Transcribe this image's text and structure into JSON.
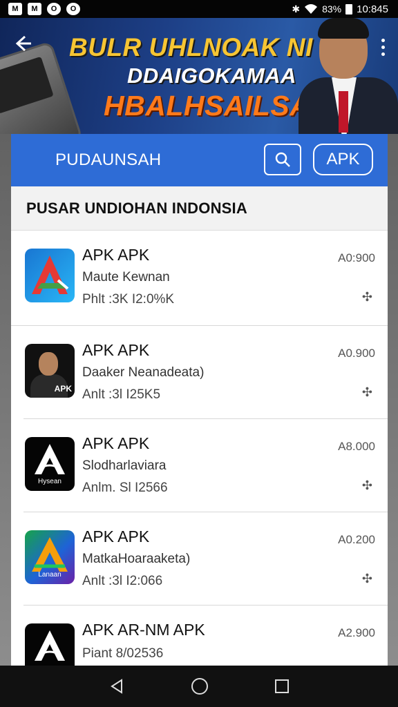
{
  "status_bar": {
    "icons_left": [
      "M",
      "M",
      "O",
      "O"
    ],
    "battery": "83%",
    "time": "10:845"
  },
  "banner": {
    "line1": "BULR UHLNOAK NI",
    "line2": "DDAIGOKAMAA",
    "line3": "HBALHSAILSAN!"
  },
  "header": {
    "title": "PUDAUNSAH",
    "apk_button_label": "APK"
  },
  "section": {
    "title": "PUSAR UNDIOHAN INDONSIA"
  },
  "items": [
    {
      "title": "APK APK",
      "subtitle": "Maute Kewnan",
      "meta": "Phlt :3K I2:0%K",
      "size": "A0:900"
    },
    {
      "title": "APK APK",
      "subtitle": "Daaker Neanadeata)",
      "meta": "Anlt :3l I25K5",
      "size": "A0.900",
      "icon_tag": "APK"
    },
    {
      "title": "APK APK",
      "subtitle": "Slodharlaviara",
      "meta": "Anlm. Sl I2566",
      "size": "A8.000",
      "icon_tag": "Hysean"
    },
    {
      "title": "APK APK",
      "subtitle": "MatkaHoaraaketa)",
      "meta": "Anlt :3l I2:066",
      "size": "A0.200",
      "icon_tag": "Lanaan"
    },
    {
      "title": "APK AR-NM APK",
      "subtitle": "",
      "meta": "Piant 8/02536",
      "size": "A2.900"
    }
  ],
  "colors": {
    "primary": "#2e6cd6",
    "banner_yellow": "#f7c533",
    "banner_orange": "#ff7a1a"
  },
  "icons": [
    "back-arrow-icon",
    "search-icon",
    "download-icon",
    "nav-back-icon",
    "nav-home-icon",
    "nav-recents-icon"
  ]
}
